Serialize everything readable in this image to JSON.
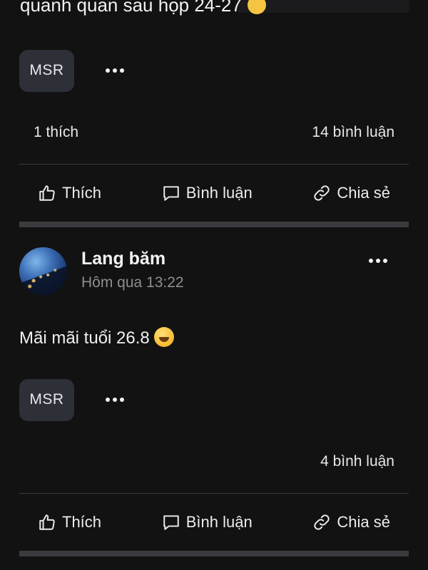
{
  "top_post": {
    "partial_text": "quanh quan sau họp 24-27",
    "chip_label": "MSR",
    "likes_text": "1 thích",
    "comments_text": "14 bình luận"
  },
  "actions": {
    "like_label": "Thích",
    "comment_label": "Bình luận",
    "share_label": "Chia sẻ"
  },
  "second_post": {
    "author": "Lang băm",
    "time": "Hôm qua 13:22",
    "body": "Mãi mãi tuổi 26.8",
    "chip_label": "MSR",
    "comments_text": "4 bình luận"
  },
  "icons": {
    "like": "thumbs-up-icon",
    "comment": "comment-bubble-icon",
    "share": "link-icon",
    "more": "more-dots-icon"
  },
  "colors": {
    "background": "#121212",
    "chip": "#2e3038",
    "separator": "#3a3b3e",
    "muted_text": "#8e8e93"
  }
}
